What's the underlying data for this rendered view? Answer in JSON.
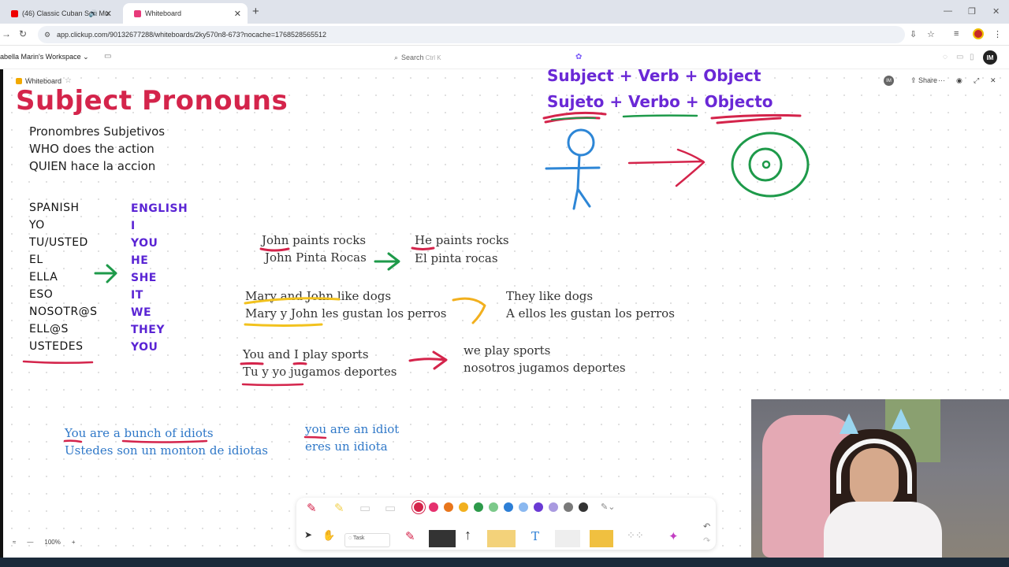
{
  "browser": {
    "tabs": [
      {
        "label": "(46) Classic Cuban Son Mu",
        "active": false
      },
      {
        "label": "Whiteboard",
        "active": true
      }
    ],
    "url": "app.clickup.com/90132677288/whiteboards/2ky570n8-673?nocache=1768528565512"
  },
  "clickup": {
    "workspace": "abella Marin's Workspace",
    "search_label": "Search",
    "search_shortcut": "Ctrl K",
    "avatar_initials": "IM",
    "whiteboard_label": "Whiteboard",
    "share_label": "Share"
  },
  "board": {
    "title": "Subject Pronouns",
    "subtitles": [
      "Pronombres Subjetivos",
      "WHO does the action",
      "QUIEN hace la accion"
    ],
    "spanish_header": "SPANISH",
    "english_header": "ENGLISH",
    "spanish": [
      "YO",
      "TU/USTED",
      "EL",
      "ELLA",
      "ESO",
      "NOSOTR@S",
      "ELL@S",
      "USTEDES"
    ],
    "english": [
      "I",
      "YOU",
      "HE",
      "SHE",
      "IT",
      "WE",
      "THEY",
      "YOU"
    ],
    "formula_en": "Subject + Verb + Object",
    "formula_es": "Sujeto + Verbo + Objecto",
    "ex1": {
      "a1": "John paints rocks",
      "a2": "John Pinta Rocas",
      "b1": "He paints rocks",
      "b2": "El pinta rocas"
    },
    "ex2": {
      "a1": "Mary and John like dogs",
      "a2": "Mary y John les gustan los perros",
      "b1": "They like dogs",
      "b2": "A ellos les gustan los perros"
    },
    "ex3": {
      "a1": "You and I play sports",
      "a2": "Tu y yo jugamos deportes",
      "b1": "we play sports",
      "b2": "nosotros jugamos deportes"
    },
    "ex4": {
      "a1": "You are a bunch of idiots",
      "a2": "Ustedes son un monton de idiotas",
      "b1": "you are an idiot",
      "b2": "eres un idiota"
    }
  },
  "toolbar": {
    "colors": [
      "#d4244b",
      "#e5306e",
      "#e8761c",
      "#f2b01e",
      "#2d9a4a",
      "#7cc98a",
      "#2d7fd6",
      "#8ab8f0",
      "#6a3ad4",
      "#a99ae0",
      "#7a7a7a",
      "#333333"
    ],
    "task_label": "Task",
    "zoom": "100%"
  }
}
